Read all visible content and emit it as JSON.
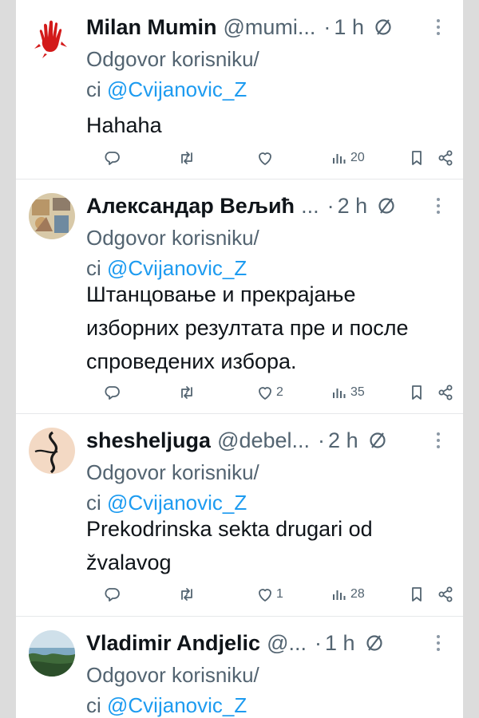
{
  "tweets": [
    {
      "name": "Milan Mumin",
      "handle": "@mumi...",
      "dot": "·",
      "time": "1 h",
      "reply_prefix": "Odgovor korisniku/",
      "reply_suffix": "ci",
      "mention": "@Cvijanovic_Z",
      "text": "Hahaha",
      "likes": "",
      "views": "20",
      "avatar_icon": "red-hand-avatar"
    },
    {
      "name": "Александар Вељић",
      "handle": "...",
      "dot": "·",
      "time": "2 h",
      "reply_prefix": "Odgovor korisniku/",
      "reply_suffix": "ci",
      "mention": "@Cvijanovic_Z",
      "text": "Штанцовање и прекрајање изборних резултата пре и после спроведених избора.",
      "likes": "2",
      "views": "35",
      "avatar_icon": "painting-avatar"
    },
    {
      "name": "shesheljuga",
      "handle": "@debel...",
      "dot": "·",
      "time": "2 h",
      "reply_prefix": "Odgovor korisniku/",
      "reply_suffix": "ci",
      "mention": "@Cvijanovic_Z",
      "text": "Prekodrinska sekta drugari od žvalavog",
      "likes": "1",
      "views": "28",
      "avatar_icon": "tennis-ball-avatar"
    },
    {
      "name": "Vladimir Andjelic",
      "handle": "@...",
      "dot": "·",
      "time": "1 h",
      "reply_prefix": "Odgovor korisniku/",
      "reply_suffix": "ci",
      "mention": "@Cvijanovic_Z",
      "text": "",
      "likes": "",
      "views": "",
      "avatar_icon": "landscape-avatar"
    }
  ],
  "colors": {
    "text": "#0f1419",
    "secondary": "#536471",
    "link": "#1d9bf0",
    "divider": "#e6e8ea"
  },
  "icons": [
    "reply-icon",
    "retweet-icon",
    "like-icon",
    "views-icon",
    "bookmark-icon",
    "share-icon",
    "grok-icon",
    "more-icon"
  ]
}
